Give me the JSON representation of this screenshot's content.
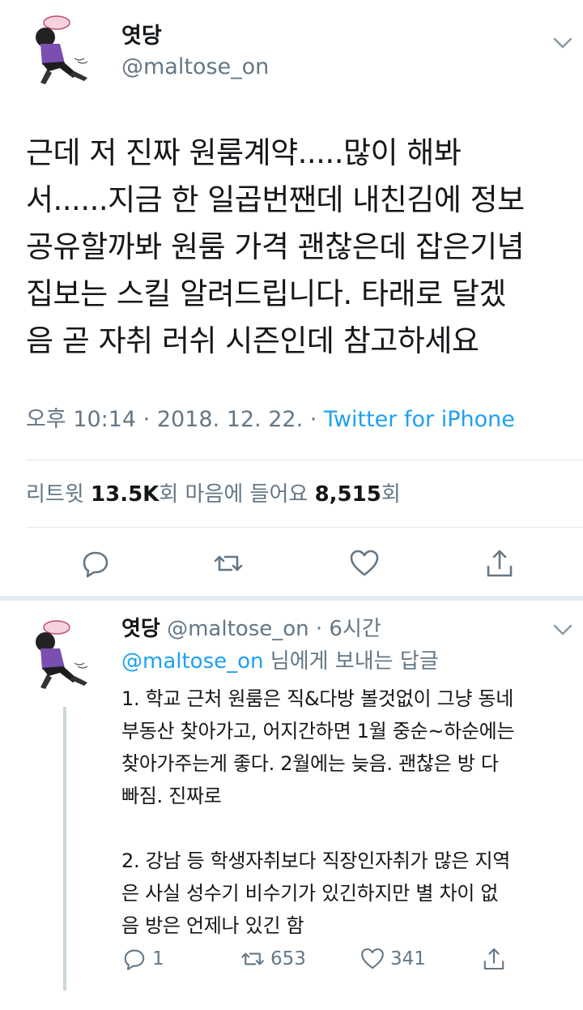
{
  "main_tweet": {
    "display_name": "엿당",
    "handle": "@maltose_on",
    "text_lines": [
      "근데 저 진짜 원룸계약.....많이 해봐",
      "서......지금 한 일곱번짼데 내친김에 정보",
      "공유할까봐 원룸 가격 괜찮은데 잡은기념",
      "집보는 스킬 알려드립니다. 타래로 달겠",
      "음 곧 자취 러쉬 시즌인데 참고하세요"
    ],
    "timestamp": "오후 10:14 · 2018. 12. 22. · ",
    "source": "Twitter for iPhone",
    "retweets_label": "리트윗 ",
    "retweets_count": "13.5K",
    "retweets_suffix": "회  마음에 들어요 ",
    "likes_count": "8,515",
    "likes_suffix": "회"
  },
  "reply_tweet": {
    "display_name": "엿당",
    "handle": " @maltose_on",
    "time": " · 6시간",
    "reply_to_mention": "@maltose_on",
    "reply_to_suffix": " 님에게 보내는 답글",
    "paragraph1": [
      "1. 학교 근처 원룸은 직&다방 볼것없이 그냥 동네",
      "부동산 찾아가고, 어지간하면 1월 중순~하순에는",
      "찾아가주는게 좋다. 2월에는 늦음. 괜찮은 방 다",
      "빠짐. 진짜로"
    ],
    "paragraph2": [
      "2. 강남 등 학생자취보다 직장인자취가 많은 지역",
      "은 사실 성수기 비수기가 있긴하지만 별 차이 없",
      "음 방은 언제나 있긴 함"
    ],
    "reply_count": "1",
    "retweet_count": "653",
    "like_count": "341"
  },
  "icons": {
    "reply": "reply-bubble-icon",
    "retweet": "retweet-icon",
    "like": "heart-icon",
    "share": "share-icon",
    "caret": "chevron-down-icon"
  },
  "colors": {
    "text": "#14171a",
    "secondary": "#657786",
    "link": "#1da1f2",
    "divider": "#e1e8ed"
  }
}
